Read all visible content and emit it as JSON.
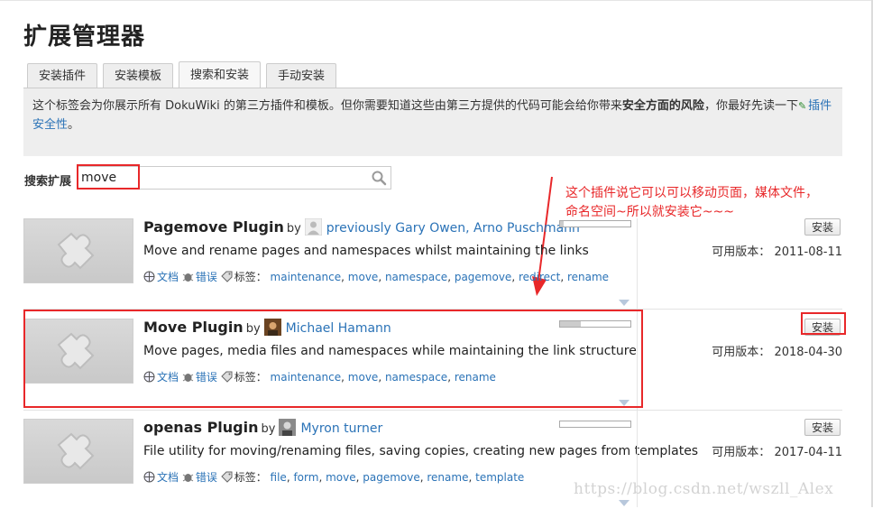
{
  "page": {
    "title": "扩展管理器"
  },
  "tabs": [
    {
      "label": "安装插件"
    },
    {
      "label": "安装模板"
    },
    {
      "label": "搜索和安装"
    },
    {
      "label": "手动安装"
    }
  ],
  "intro": {
    "text1": "这个标签会为你展示所有 DokuWiki 的第三方插件和模板。但你需要知道这些由第三方提供的代码可能会给你带来",
    "bold": "安全方面的风险",
    "text2": "，你最好先读一下",
    "link": "插件安全性",
    "text3": "。"
  },
  "search": {
    "label": "搜索扩展",
    "value": "move"
  },
  "annotation": {
    "line1": "这个插件说它可以可以移动页面，媒体文件，",
    "line2": "命名空间~所以就安装它~~~"
  },
  "common": {
    "by": "by",
    "docs": "文档",
    "bugs": "错误",
    "tags_label": "标签：",
    "install": "安装",
    "version_label": "可用版本："
  },
  "plugins": [
    {
      "name": "Pagemove Plugin",
      "author": "previously Gary Owen, Arno Puschmann",
      "description": "Move and rename pages and namespaces whilst maintaining the links",
      "tags": [
        "maintenance",
        "move",
        "namespace",
        "pagemove",
        "redirect",
        "rename"
      ],
      "version": "2011-08-11",
      "popularity": 0.05
    },
    {
      "name": "Move Plugin",
      "author": "Michael Hamann",
      "description": "Move pages, media files and namespaces while maintaining the link structure",
      "tags": [
        "maintenance",
        "move",
        "namespace",
        "rename"
      ],
      "version": "2018-04-30",
      "popularity": 0.3
    },
    {
      "name": "openas Plugin",
      "author": "Myron turner",
      "description": "File utility for moving/renaming files, saving copies, creating new pages from templates",
      "tags": [
        "file",
        "form",
        "move",
        "pagemove",
        "rename",
        "template"
      ],
      "version": "2017-04-11",
      "popularity": 0.0
    }
  ],
  "watermark": "https://blog.csdn.net/wszll_Alex",
  "colors": {
    "accent": "#e8282a",
    "link": "#2b73b7"
  }
}
